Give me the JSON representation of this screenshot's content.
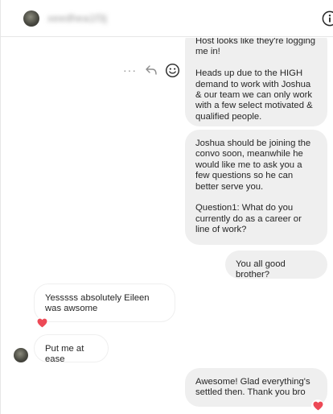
{
  "header": {
    "username": "xeedhea1f3j",
    "info_icon": "info-icon"
  },
  "messages": [
    {
      "direction": "out",
      "text": "Host looks like they're logging me in!\n\nHeads up due to the HIGH demand to work with Joshua & our team we can only work with a few select motivated & qualified people."
    },
    {
      "direction": "out",
      "text": "Joshua should be joining the convo soon, meanwhile he would like me to ask you a few questions so he can better serve you.\n\nQuestion1: What do you currently do as a career or line of work?"
    },
    {
      "direction": "out",
      "text": "You all good brother?"
    },
    {
      "direction": "in",
      "text": "Yesssss absolutely Eileen was awsome",
      "reaction": "heart"
    },
    {
      "direction": "in",
      "text": "Put me at ease"
    },
    {
      "direction": "out",
      "text": "Awesome! Glad everything's settled then. Thank you bro",
      "reaction": "heart"
    }
  ],
  "hover_actions": {
    "more_label": "···",
    "icons": [
      "more-icon",
      "reply-icon",
      "react-emoji-icon"
    ]
  },
  "colors": {
    "outgoing_bubble": "#efefef",
    "reaction_heart": "#ed4956",
    "icon_gray": "#8e8e8e"
  }
}
